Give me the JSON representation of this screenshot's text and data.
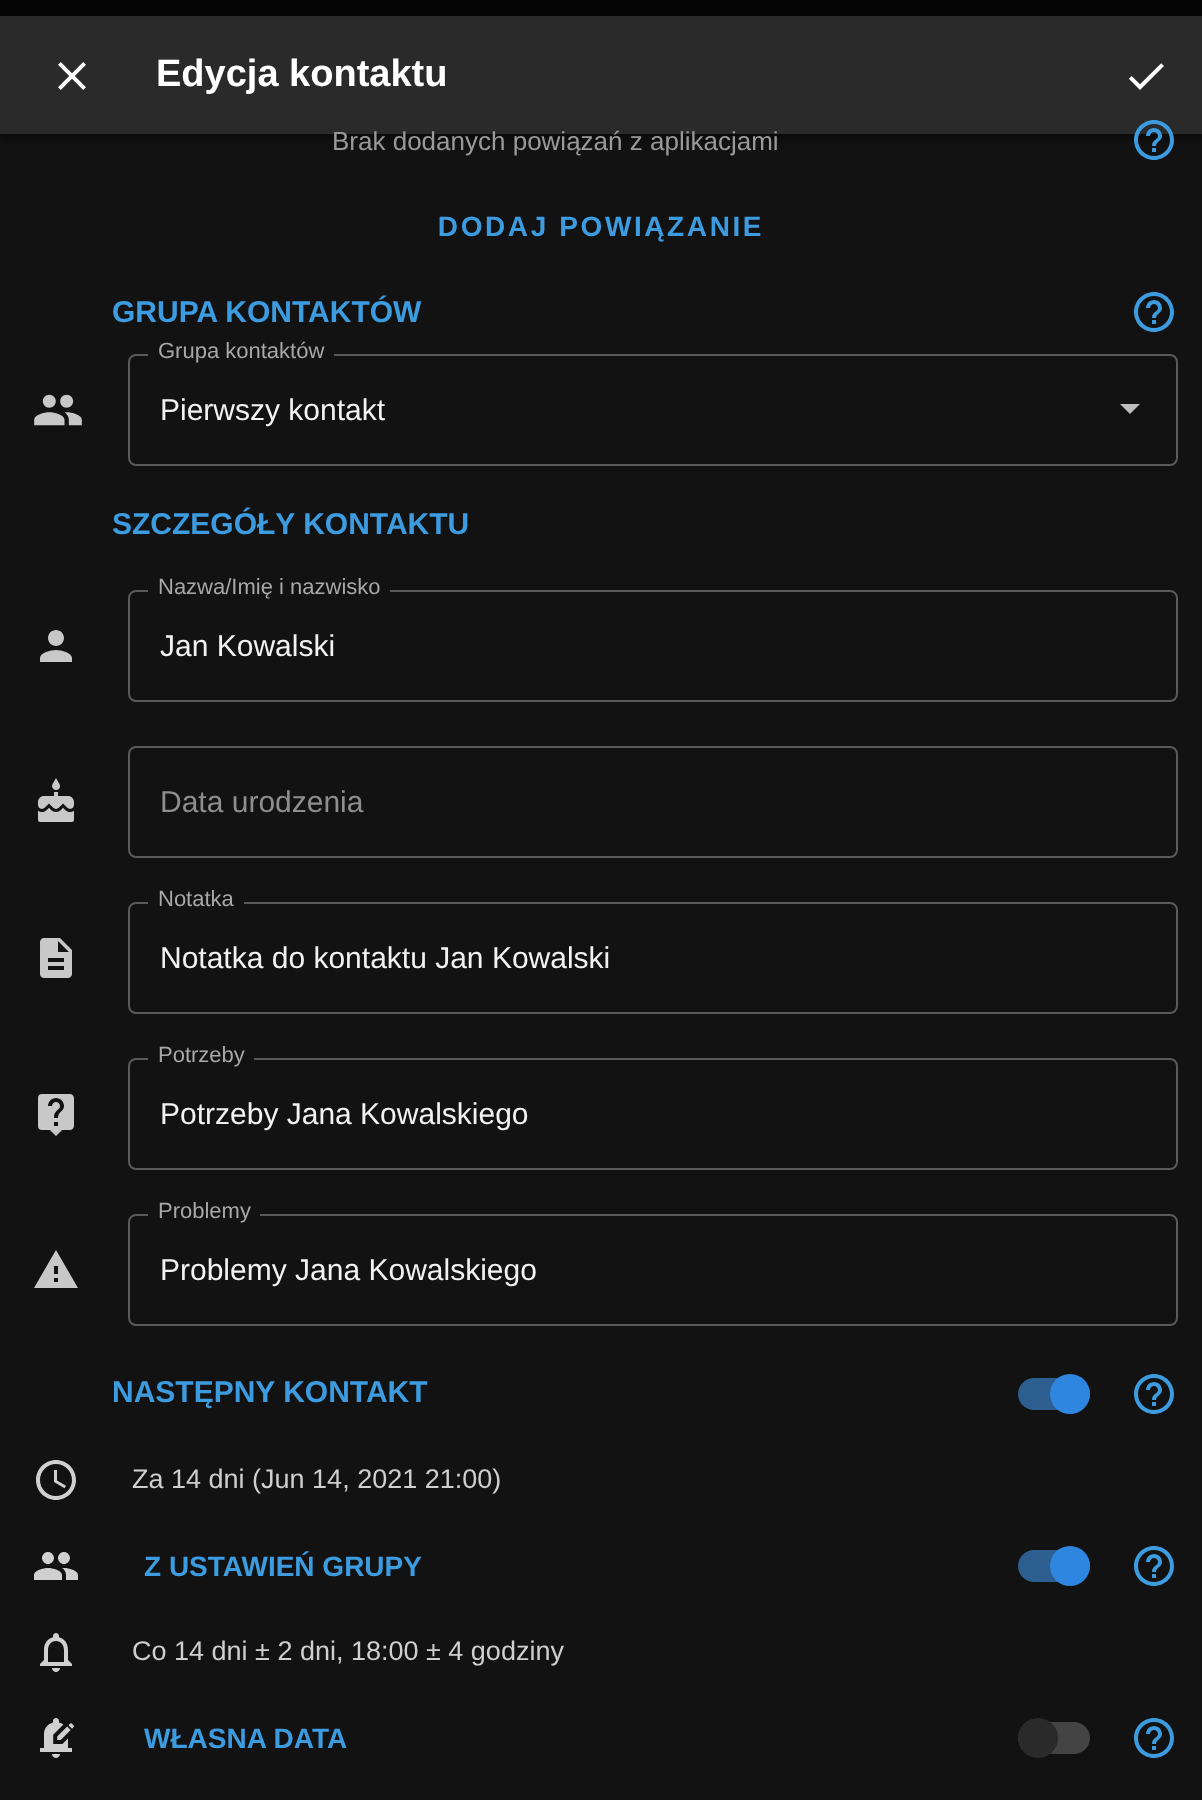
{
  "app_bar": {
    "title": "Edycja kontaktu"
  },
  "integrations": {
    "empty_text": "Brak dodanych powiązań z aplikacjami",
    "add_button": "DODAJ POWIĄZANIE"
  },
  "group_section": {
    "title": "GRUPA KONTAKTÓW",
    "field": {
      "label": "Grupa kontaktów",
      "value": "Pierwszy kontakt"
    }
  },
  "details_section": {
    "title": "SZCZEGÓŁY KONTAKTU",
    "fields": [
      {
        "label": "Nazwa/Imię i nazwisko",
        "value": "Jan Kowalski"
      },
      {
        "placeholder": "Data urodzenia"
      },
      {
        "label": "Notatka",
        "value": "Notatka do kontaktu Jan Kowalski"
      },
      {
        "label": "Potrzeby",
        "value": "Potrzeby Jana Kowalskiego"
      },
      {
        "label": "Problemy",
        "value": "Problemy Jana Kowalskiego"
      }
    ]
  },
  "next_contact": {
    "rows": [
      {
        "kind": "header",
        "label": "NASTĘPNY KONTAKT",
        "on": true
      },
      {
        "kind": "info",
        "text": "Za 14 dni (Jun 14, 2021 21:00)"
      },
      {
        "kind": "toggle",
        "label": "Z USTAWIEŃ GRUPY",
        "on": true
      },
      {
        "kind": "info",
        "text": "Co 14 dni ± 2 dni, 18:00 ± 4 godziny"
      },
      {
        "kind": "toggle",
        "label": "WŁASNA DATA",
        "on": false
      }
    ]
  }
}
